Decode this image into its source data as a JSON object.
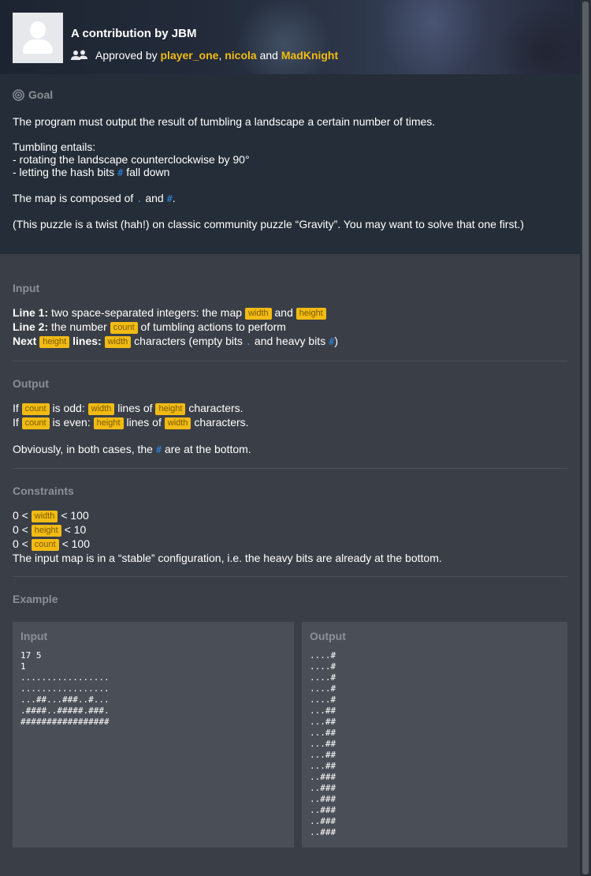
{
  "header": {
    "title": "A contribution by JBM",
    "approved_prefix": "Approved by",
    "approvers": [
      "player_one",
      "nicola",
      "MadKnight"
    ],
    "sep1": ",",
    "and_word": "and"
  },
  "goal": {
    "label": "Goal",
    "p1": "The program must output the result of tumbling a landscape a certain number of times.",
    "tumbling_intro": "Tumbling entails:",
    "tumbling_1": "- rotating the landscape counterclockwise by 90°",
    "tumbling_2_pre": "- letting the hash bits",
    "tumbling_2_post": "fall down",
    "map_pre": "The map is composed of",
    "map_and": "and",
    "map_end": ".",
    "note": "(This puzzle is a twist (hah!) on classic community puzzle “Gravity”. You may want to solve that one first.)",
    "dot_symbol": ".",
    "hash_symbol": "#"
  },
  "input": {
    "label": "Input",
    "l1_bold": "Line 1:",
    "l1_text": "two space-separated integers: the map",
    "l1_and": "and",
    "l2_bold": "Line 2:",
    "l2_text": "the number",
    "l2_post": "of tumbling actions to perform",
    "l3_bold": "Next",
    "l3_bold2": "lines:",
    "l3_text": "characters (empty bits",
    "l3_text2": "and heavy bits",
    "l3_end": ")"
  },
  "output": {
    "label": "Output",
    "o1_pre": "If",
    "o1_mid": "is odd:",
    "o1_lines": "lines of",
    "o1_end": "characters.",
    "o2_pre": "If",
    "o2_mid": "is even:",
    "o2_lines": "lines of",
    "o2_end": "characters.",
    "o3_pre": "Obviously, in both cases, the",
    "o3_post": "are at the bottom."
  },
  "constraints": {
    "label": "Constraints",
    "c1_pre": "0 <",
    "c1_post": "< 100",
    "c2_pre": "0 <",
    "c2_post": "< 10",
    "c3_pre": "0 <",
    "c3_post": "< 100",
    "c4": "The input map is in a “stable” configuration, i.e. the heavy bits are already at the bottom."
  },
  "vars": {
    "width": "width",
    "height": "height",
    "count": "count"
  },
  "example": {
    "label": "Example",
    "input_title": "Input",
    "output_title": "Output",
    "input_text": "17 5\n1\n.................\n.................\n...##...###..#...\n.####..#####.###.\n#################",
    "output_text": "....#\n....#\n....#\n....#\n....#\n...##\n...##\n...##\n...##\n...##\n...##\n..###\n..###\n..###\n..###\n..###\n..###"
  },
  "colors": {
    "accent": "#f2bb13",
    "code": "#2c8ae8"
  }
}
